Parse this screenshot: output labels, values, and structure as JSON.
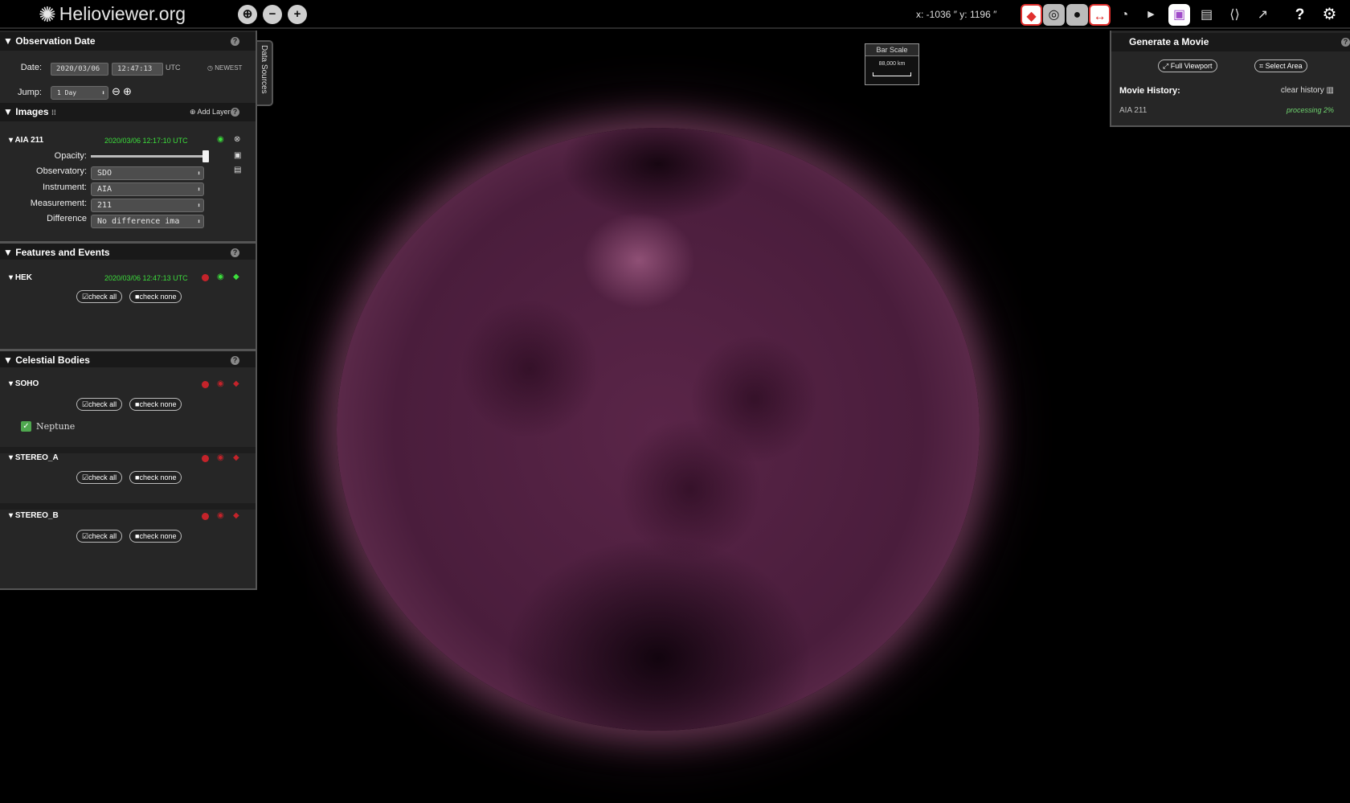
{
  "header": {
    "logo_text": "Helioviewer.org",
    "coords": "x: -1036 ″  y: 1196 ″"
  },
  "observation": {
    "title": "Observation Date",
    "date_label": "Date:",
    "date": "2020/03/06",
    "time": "12:47:13",
    "tz": "UTC",
    "newest": "NEWEST",
    "jump_label": "Jump:",
    "jump_value": "1 Day"
  },
  "images": {
    "title": "Images",
    "add_layer": "Add Layer",
    "layer_name": "AIA 211",
    "layer_time": "2020/03/06 12:17:10 UTC",
    "opacity_label": "Opacity:",
    "opacity": 1.0,
    "observatory_label": "Observatory:",
    "observatory": "SDO",
    "instrument_label": "Instrument:",
    "instrument": "AIA",
    "measurement_label": "Measurement:",
    "measurement": "211",
    "difference_label": "Difference",
    "difference": "No difference ima"
  },
  "features": {
    "title": "Features and Events",
    "hek_name": "HEK",
    "hek_time": "2020/03/06 12:47:13 UTC",
    "check_all": "check all",
    "check_none": "check none"
  },
  "celestial": {
    "title": "Celestial Bodies",
    "soho": "SOHO",
    "neptune": "Neptune",
    "stereo_a": "STEREO_A",
    "stereo_b": "STEREO_B"
  },
  "datasources_tab": "Data Sources",
  "barscale": {
    "title": "Bar Scale",
    "value": "88,000 km"
  },
  "movie": {
    "title": "Generate a Movie",
    "full_viewport": "Full Viewport",
    "select_area": "Select Area",
    "history_label": "Movie History:",
    "clear_history": "clear history",
    "item_name": "AIA 211",
    "item_status": "processing 2%"
  },
  "colors": {
    "accent_green": "#3cde3c",
    "alert_red": "#e0302e",
    "sun_tint": "#6b3556"
  }
}
